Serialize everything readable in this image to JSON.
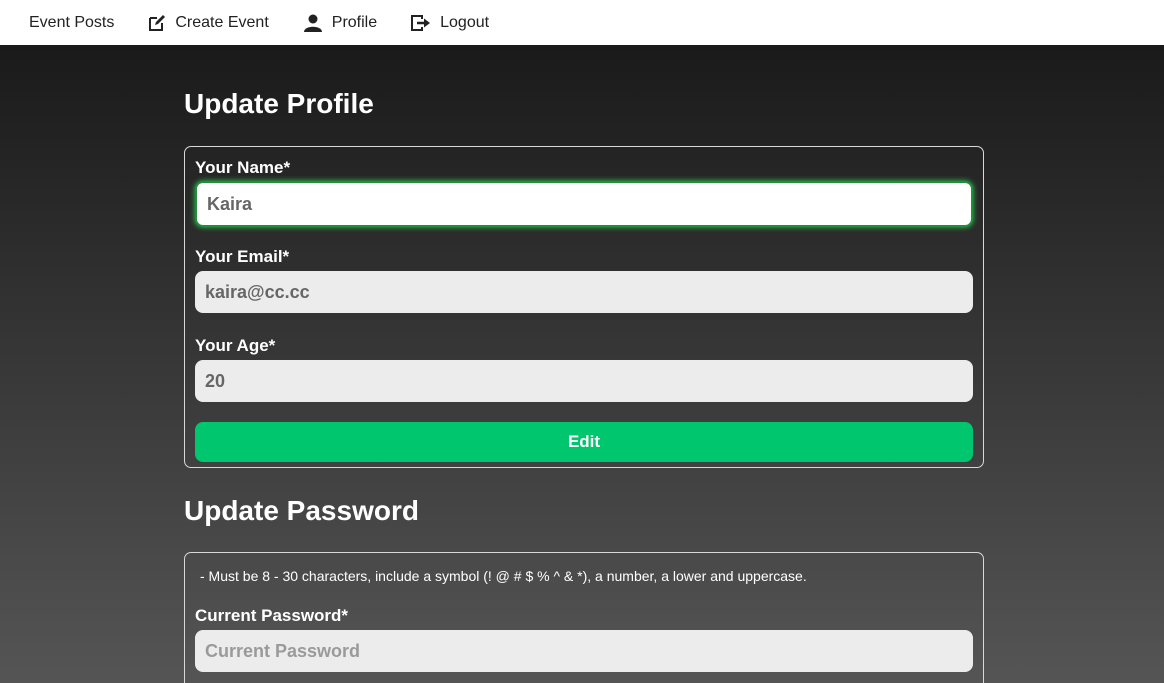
{
  "nav": {
    "items": [
      {
        "label": "Event Posts",
        "icon": "none"
      },
      {
        "label": "Create Event",
        "icon": "edit-icon"
      },
      {
        "label": "Profile",
        "icon": "user-icon"
      },
      {
        "label": "Logout",
        "icon": "logout-icon"
      }
    ]
  },
  "profile": {
    "title": "Update Profile",
    "name_label": "Your Name*",
    "name_value": "Kaira",
    "email_label": "Your Email*",
    "email_value": "kaira@cc.cc",
    "age_label": "Your Age*",
    "age_value": "20",
    "edit_label": "Edit"
  },
  "password": {
    "title": "Update Password",
    "hint": "- Must be 8 - 30 characters, include a symbol (! @ # $ % ^ & *), a number, a lower and uppercase.",
    "current_label": "Current Password*",
    "current_placeholder": "Current Password"
  },
  "colors": {
    "accent": "#00c66e",
    "focus": "#1e8f3a"
  }
}
